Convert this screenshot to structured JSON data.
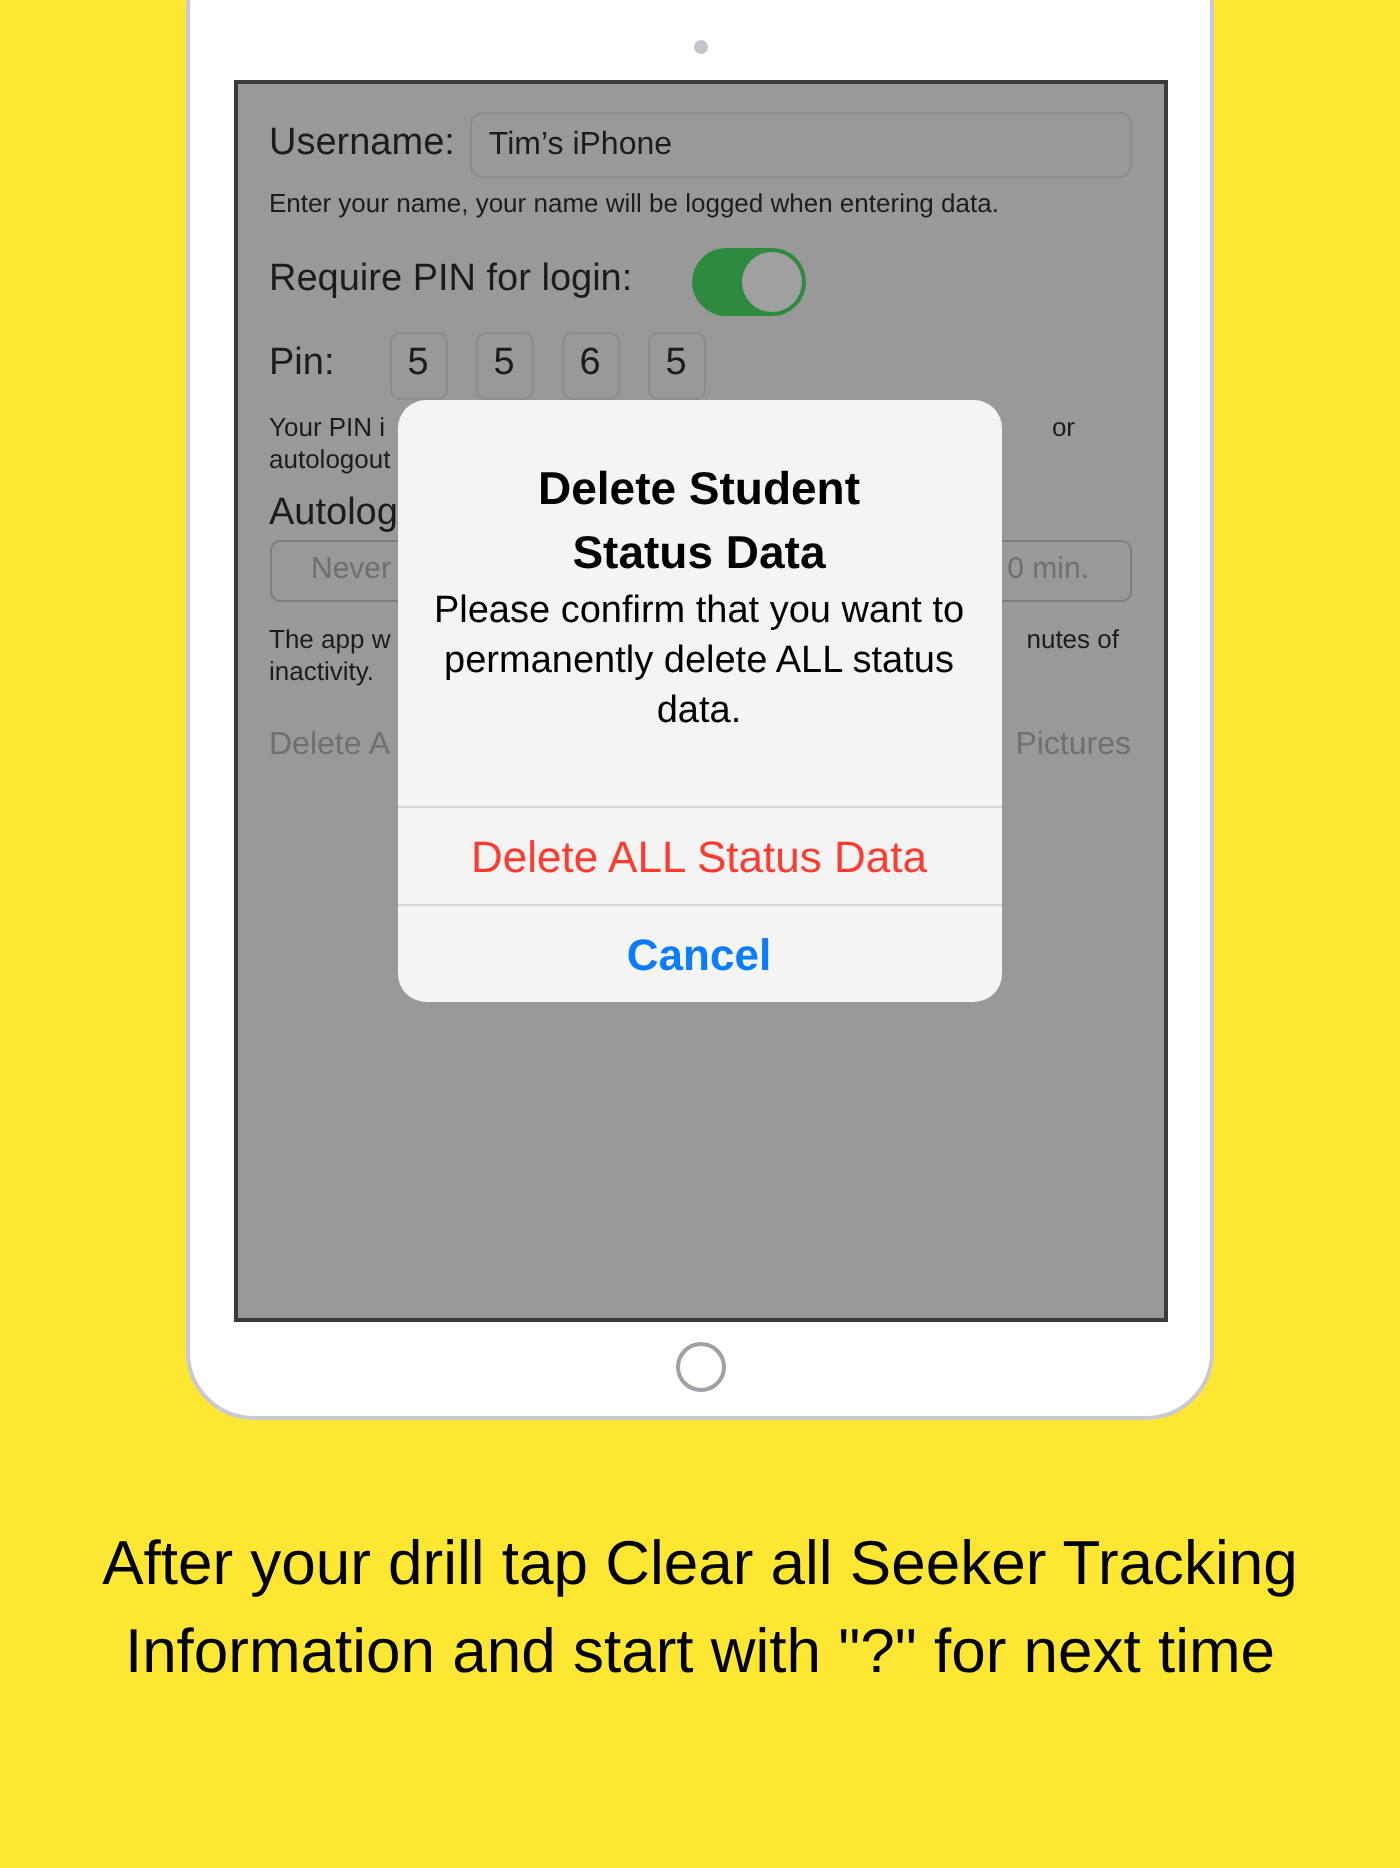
{
  "settings": {
    "username_label": "Username:",
    "username_value": "Tim’s iPhone",
    "username_hint": "Enter your name,  your name will be logged when entering data.",
    "pin_required_label": "Require PIN for login:",
    "pin_required_on": true,
    "pin_label": "Pin:",
    "pin_digits": [
      "5",
      "5",
      "6",
      "5"
    ],
    "pin_note_left": [
      "Your PIN i",
      "autologout"
    ],
    "pin_note_right": "or",
    "autologout_label": "Autolog",
    "autologout_options": [
      "Never",
      "0 min."
    ],
    "autologout_note_left": [
      "The app w",
      "inactivity."
    ],
    "autologout_note_right": "nutes of",
    "delete_left": "Delete A",
    "delete_right": "Pictures"
  },
  "alert": {
    "title": "Delete Student Status Data",
    "message": "Please confirm that you want to permanently delete ALL status data.",
    "actions": [
      {
        "label": "Delete ALL Status Data",
        "kind": "destructive"
      },
      {
        "label": "Cancel",
        "kind": "cancel"
      }
    ]
  },
  "caption": "After your drill tap Clear all Seeker Tracking Information and start with \"?\" for next time"
}
